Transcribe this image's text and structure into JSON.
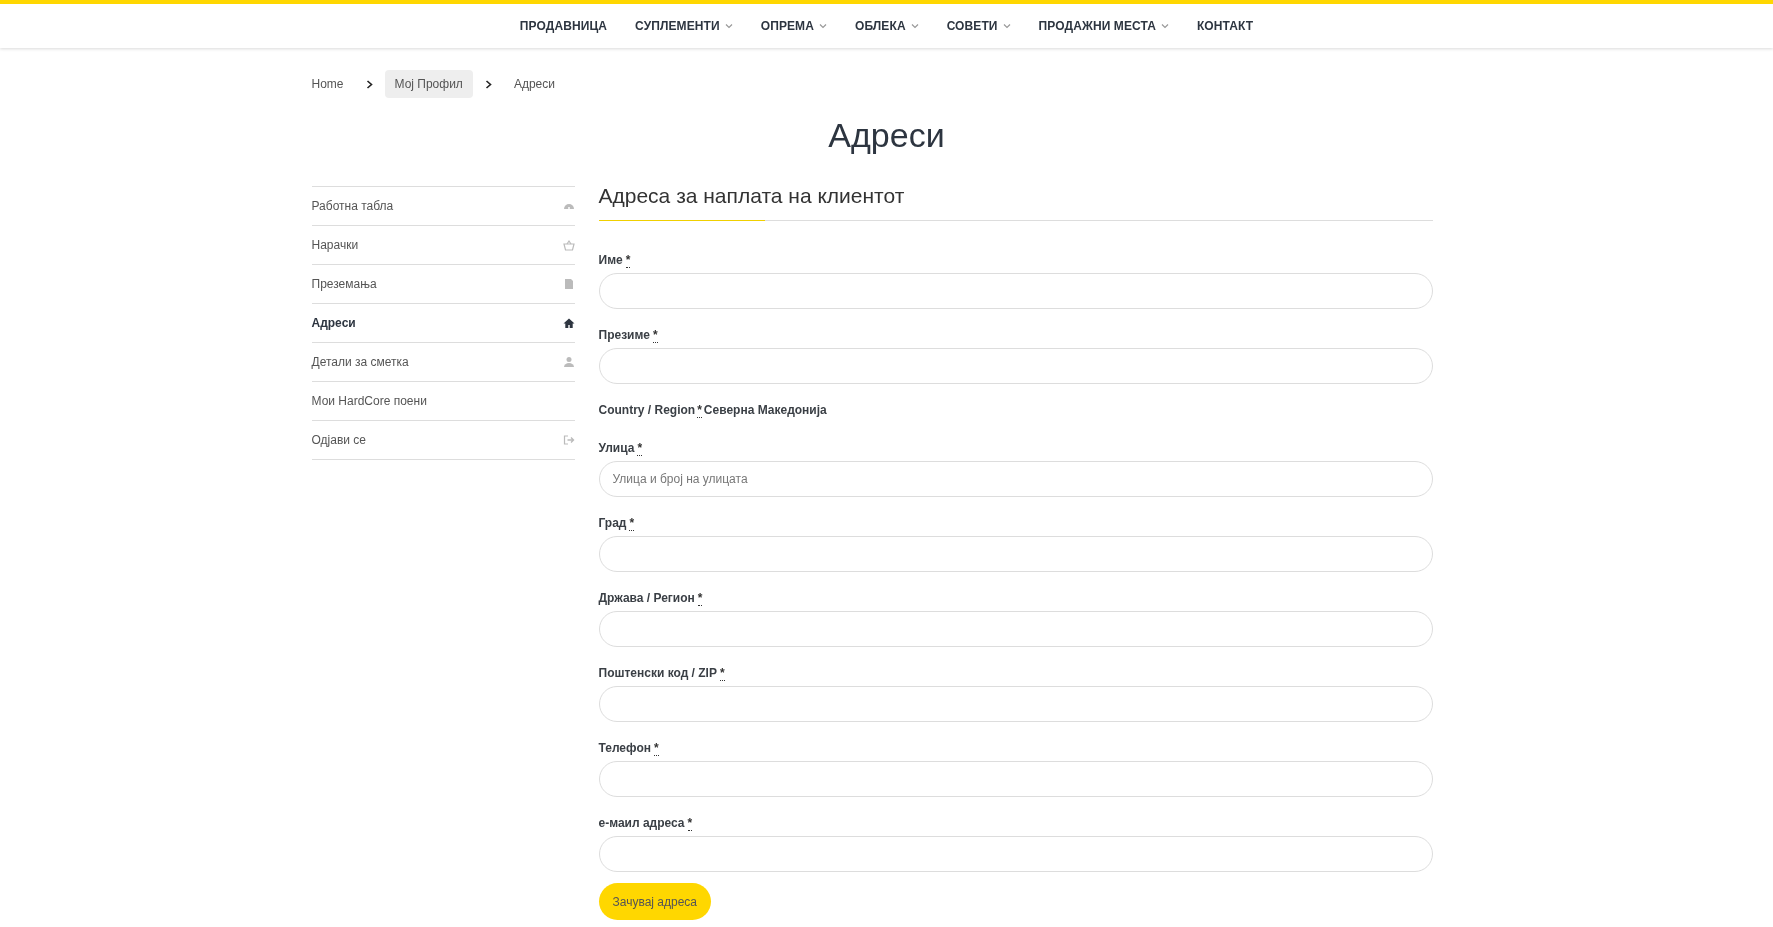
{
  "nav": {
    "items": [
      {
        "label": "ПРОДАВНИЦА",
        "dropdown": false
      },
      {
        "label": "СУПЛЕМЕНТИ",
        "dropdown": true
      },
      {
        "label": "ОПРЕМА",
        "dropdown": true
      },
      {
        "label": "ОБЛЕКА",
        "dropdown": true
      },
      {
        "label": "СОВЕТИ",
        "dropdown": true
      },
      {
        "label": "ПРОДАЖНИ МЕСТА",
        "dropdown": true
      },
      {
        "label": "КОНТАКТ",
        "dropdown": false
      }
    ]
  },
  "breadcrumb": [
    {
      "label": "Home",
      "highlighted": false
    },
    {
      "label": "Мој Профил",
      "highlighted": true
    },
    {
      "label": "Адреси",
      "highlighted": false
    }
  ],
  "page_title": "Адреси",
  "sidebar": {
    "items": [
      {
        "label": "Работна табла",
        "selected": false,
        "kind": "dashboard"
      },
      {
        "label": "Нарачки",
        "selected": false,
        "kind": "orders"
      },
      {
        "label": "Преземања",
        "selected": false,
        "kind": "downloads"
      },
      {
        "label": "Адреси",
        "selected": true,
        "kind": "addresses"
      },
      {
        "label": "Детали за сметка",
        "selected": false,
        "kind": "account"
      },
      {
        "label": "Мои HardCore поени",
        "selected": false,
        "kind": "points"
      },
      {
        "label": "Одјави се",
        "selected": false,
        "kind": "logout"
      }
    ]
  },
  "form": {
    "heading": "Адреса за наплата на клиентот",
    "fields": [
      {
        "kind": "input",
        "label": "Име",
        "required_mark": "*"
      },
      {
        "kind": "input",
        "label": "Презиме",
        "required_mark": "*"
      },
      {
        "kind": "static",
        "label": "Country / Region",
        "required_mark": "*",
        "value": "Северна Македонија"
      },
      {
        "kind": "input",
        "label": "Улица",
        "required_mark": "*",
        "placeholder": "Улица и број на улицата"
      },
      {
        "kind": "input",
        "label": "Град",
        "required_mark": "*"
      },
      {
        "kind": "input",
        "label": "Држава / Регион",
        "required_mark": "*"
      },
      {
        "kind": "input",
        "label": "Поштенски код / ZIP",
        "required_mark": "*"
      },
      {
        "kind": "input",
        "label": "Телефон",
        "required_mark": "*"
      },
      {
        "kind": "input",
        "label": "е-маил адреса",
        "required_mark": "*"
      }
    ],
    "submit": "Зачувај адреса"
  }
}
